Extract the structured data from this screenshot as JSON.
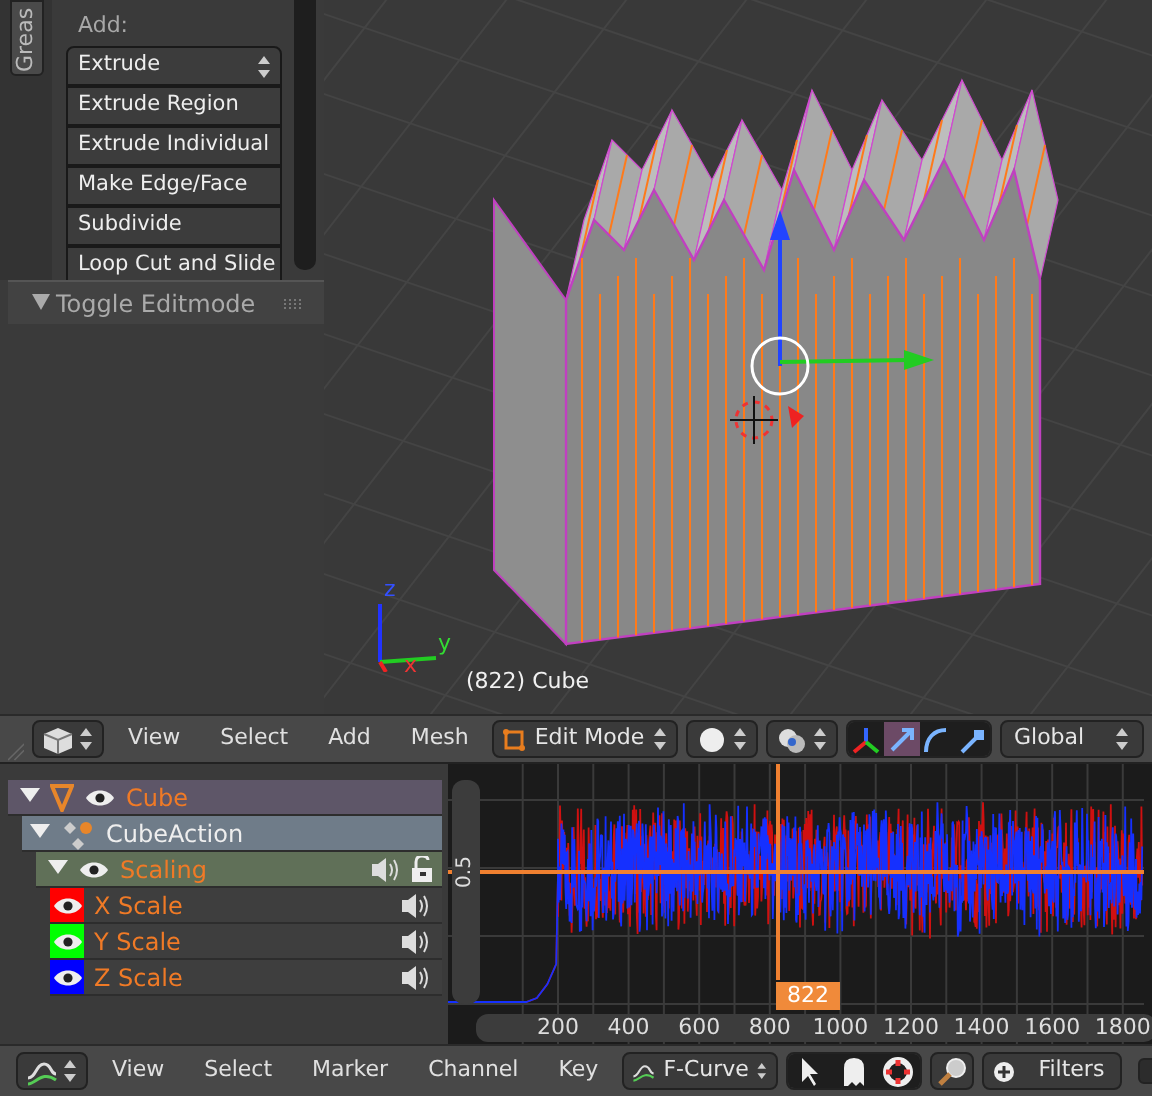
{
  "tool_panel": {
    "tab": "Greas",
    "section_label": "Add:",
    "buttons": [
      {
        "label": "Extrude",
        "kind": "dropdown"
      },
      {
        "label": "Extrude Region",
        "kind": "button"
      },
      {
        "label": "Extrude Individual",
        "kind": "button"
      },
      {
        "label": "Make Edge/Face",
        "kind": "button"
      },
      {
        "label": "Subdivide",
        "kind": "button"
      },
      {
        "label": "Loop Cut and Slide",
        "kind": "button"
      }
    ],
    "operator_panel": {
      "title": "Toggle Editmode",
      "expanded": true
    }
  },
  "viewport": {
    "axis_labels": {
      "z": "z",
      "y": "y",
      "x": "x"
    },
    "object_label": "(822) Cube"
  },
  "viewport_header": {
    "menus": [
      "View",
      "Select",
      "Add",
      "Mesh"
    ],
    "mode": "Edit Mode",
    "manipulator_on": true,
    "widgets": [
      {
        "kind": "translate",
        "selected": true
      },
      {
        "kind": "rotate",
        "selected": false
      },
      {
        "kind": "scale",
        "selected": false
      }
    ],
    "orientation": "Global"
  },
  "channels": [
    {
      "name": "Cube",
      "kind": "object",
      "expanded": true
    },
    {
      "name": "CubeAction",
      "kind": "action",
      "expanded": true
    },
    {
      "name": "Scaling",
      "kind": "group",
      "expanded": true
    },
    {
      "name": "X Scale",
      "kind": "curve",
      "color": "#ff0000"
    },
    {
      "name": "Y Scale",
      "kind": "curve",
      "color": "#00ff00"
    },
    {
      "name": "Z Scale",
      "kind": "curve",
      "color": "#0000ff"
    }
  ],
  "graph": {
    "y_label": "0.5",
    "x_ticks": [
      "200",
      "400",
      "600",
      "800",
      "1000",
      "1200",
      "1400",
      "1600",
      "1800"
    ],
    "current_frame": "822"
  },
  "graph_header": {
    "menus": [
      "View",
      "Select",
      "Marker",
      "Channel",
      "Key"
    ],
    "mode": "F-Curve",
    "filters": "Filters",
    "checkbox_checked": false
  }
}
